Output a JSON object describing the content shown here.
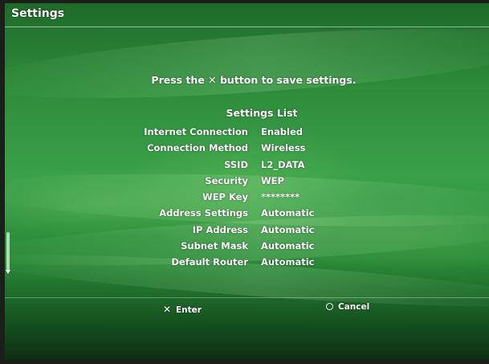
{
  "window": {
    "title": "Settings"
  },
  "instruction": "Press the ✕ button to save settings.",
  "settings_list": {
    "title": "Settings List",
    "items": [
      {
        "label": "Internet Connection",
        "value": "Enabled"
      },
      {
        "label": "Connection Method",
        "value": "Wireless"
      },
      {
        "label": "SSID",
        "value": "L2_DATA"
      },
      {
        "label": "Security",
        "value": "WEP"
      },
      {
        "label": "WEP Key",
        "value": "********"
      },
      {
        "label": "Address Settings",
        "value": "Automatic"
      },
      {
        "label": "IP Address",
        "value": "Automatic"
      },
      {
        "label": "Subnet Mask",
        "value": "Automatic"
      },
      {
        "label": "Default Router",
        "value": "Automatic"
      }
    ]
  },
  "actions": {
    "enter": {
      "icon": "cross-icon",
      "glyph": "✕",
      "label": "Enter"
    },
    "cancel": {
      "icon": "circle-icon",
      "label": "Cancel"
    }
  },
  "colors": {
    "background_green": "#2d8a3a",
    "text": "#ffffff"
  }
}
